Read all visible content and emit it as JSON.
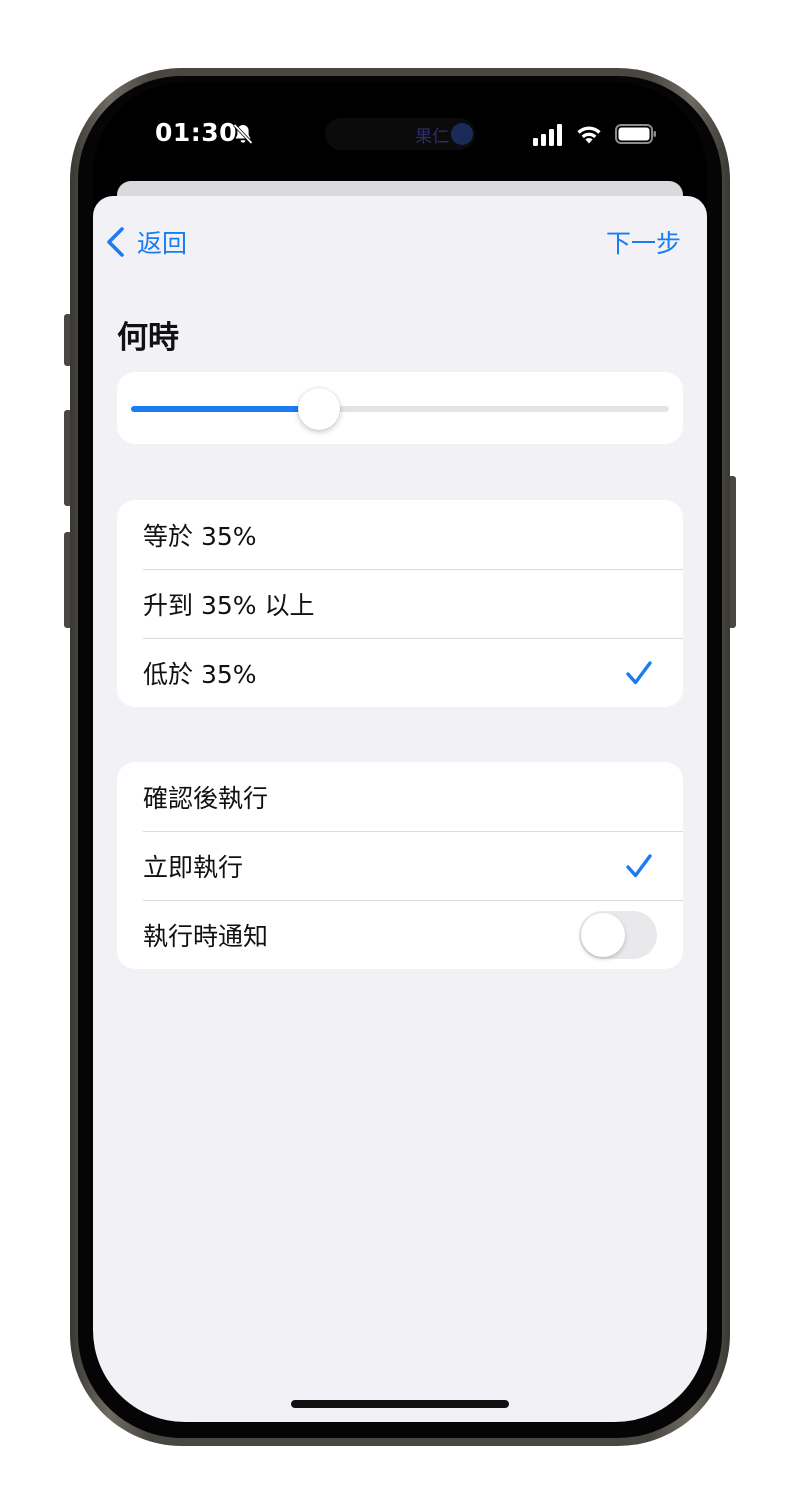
{
  "status_bar": {
    "time": "01:30",
    "island_text": "果仁"
  },
  "nav": {
    "back_label": "返回",
    "next_label": "下一步"
  },
  "when": {
    "title": "何時",
    "slider_level_percent": 35
  },
  "conditions": [
    {
      "label": "等於 35%",
      "checked": false
    },
    {
      "label": "升到 35% 以上",
      "checked": false
    },
    {
      "label": "低於 35%",
      "checked": true
    }
  ],
  "execution": [
    {
      "label": "確認後執行",
      "checked": false
    },
    {
      "label": "立即執行",
      "checked": true
    }
  ],
  "notify": {
    "label": "執行時通知",
    "on": false
  },
  "colors": {
    "accent": "#1a7cf0",
    "background": "#f1f1f6",
    "card": "#ffffff"
  }
}
